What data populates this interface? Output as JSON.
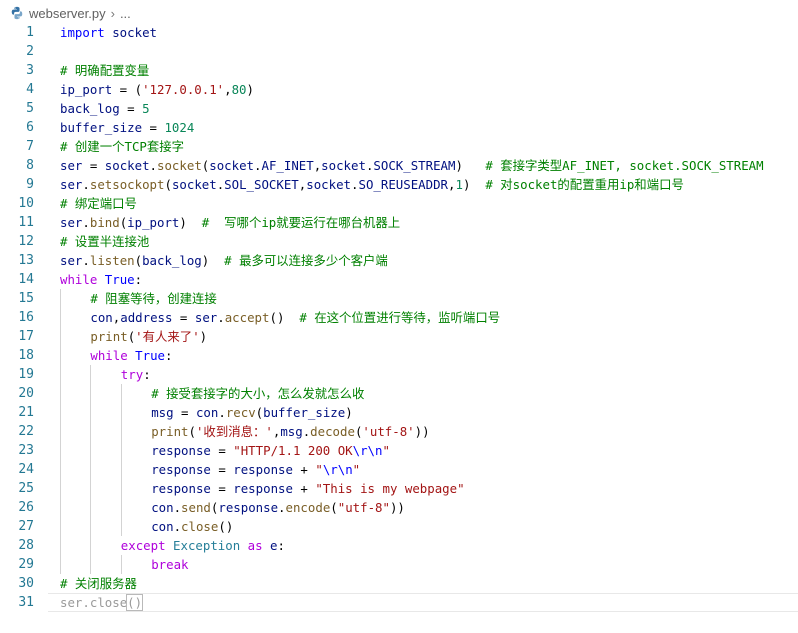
{
  "breadcrumb": {
    "file": "webserver.py",
    "separator": "›",
    "ellipsis": "..."
  },
  "colors": {
    "keyword": "#0000ff",
    "control": "#af00db",
    "comment": "#008000",
    "string": "#a31515",
    "number": "#098658",
    "function": "#795e26",
    "class": "#267f99",
    "variable": "#001080",
    "line_number": "#237893"
  },
  "lines": [
    {
      "n": "1",
      "indent": 0,
      "tokens": [
        [
          "kw",
          "import"
        ],
        [
          "v",
          " socket"
        ]
      ]
    },
    {
      "n": "2",
      "indent": 0,
      "tokens": []
    },
    {
      "n": "3",
      "indent": 0,
      "tokens": [
        [
          "cm",
          "# 明确配置变量"
        ]
      ]
    },
    {
      "n": "4",
      "indent": 0,
      "tokens": [
        [
          "v",
          "ip_port"
        ],
        [
          "op",
          " = ("
        ],
        [
          "st",
          "'127.0.0.1'"
        ],
        [
          "op",
          ","
        ],
        [
          "nu",
          "80"
        ],
        [
          "op",
          ")"
        ]
      ]
    },
    {
      "n": "5",
      "indent": 0,
      "tokens": [
        [
          "v",
          "back_log"
        ],
        [
          "op",
          " = "
        ],
        [
          "nu",
          "5"
        ]
      ]
    },
    {
      "n": "6",
      "indent": 0,
      "tokens": [
        [
          "v",
          "buffer_size"
        ],
        [
          "op",
          " = "
        ],
        [
          "nu",
          "1024"
        ]
      ]
    },
    {
      "n": "7",
      "indent": 0,
      "tokens": [
        [
          "cm",
          "# 创建一个TCP套接字"
        ]
      ]
    },
    {
      "n": "8",
      "indent": 0,
      "tokens": [
        [
          "v",
          "ser"
        ],
        [
          "op",
          " = "
        ],
        [
          "v",
          "socket"
        ],
        [
          "op",
          "."
        ],
        [
          "fn",
          "socket"
        ],
        [
          "op",
          "("
        ],
        [
          "v",
          "socket"
        ],
        [
          "op",
          "."
        ],
        [
          "v",
          "AF_INET"
        ],
        [
          "op",
          ","
        ],
        [
          "v",
          "socket"
        ],
        [
          "op",
          "."
        ],
        [
          "v",
          "SOCK_STREAM"
        ],
        [
          "op",
          ")   "
        ],
        [
          "cm",
          "# 套接字类型AF_INET, socket.SOCK_STREAM"
        ]
      ]
    },
    {
      "n": "9",
      "indent": 0,
      "tokens": [
        [
          "v",
          "ser"
        ],
        [
          "op",
          "."
        ],
        [
          "fn",
          "setsockopt"
        ],
        [
          "op",
          "("
        ],
        [
          "v",
          "socket"
        ],
        [
          "op",
          "."
        ],
        [
          "v",
          "SOL_SOCKET"
        ],
        [
          "op",
          ","
        ],
        [
          "v",
          "socket"
        ],
        [
          "op",
          "."
        ],
        [
          "v",
          "SO_REUSEADDR"
        ],
        [
          "op",
          ","
        ],
        [
          "nu",
          "1"
        ],
        [
          "op",
          ")  "
        ],
        [
          "cm",
          "# 对socket的配置重用ip和端口号"
        ]
      ]
    },
    {
      "n": "10",
      "indent": 0,
      "tokens": [
        [
          "cm",
          "# 绑定端口号"
        ]
      ]
    },
    {
      "n": "11",
      "indent": 0,
      "tokens": [
        [
          "v",
          "ser"
        ],
        [
          "op",
          "."
        ],
        [
          "fn",
          "bind"
        ],
        [
          "op",
          "("
        ],
        [
          "v",
          "ip_port"
        ],
        [
          "op",
          ")  "
        ],
        [
          "cm",
          "#  写哪个ip就要运行在哪台机器上"
        ]
      ]
    },
    {
      "n": "12",
      "indent": 0,
      "tokens": [
        [
          "cm",
          "# 设置半连接池"
        ]
      ]
    },
    {
      "n": "13",
      "indent": 0,
      "tokens": [
        [
          "v",
          "ser"
        ],
        [
          "op",
          "."
        ],
        [
          "fn",
          "listen"
        ],
        [
          "op",
          "("
        ],
        [
          "v",
          "back_log"
        ],
        [
          "op",
          ")  "
        ],
        [
          "cm",
          "# 最多可以连接多少个客户端"
        ]
      ]
    },
    {
      "n": "14",
      "indent": 0,
      "tokens": [
        [
          "kw2",
          "while"
        ],
        [
          "op",
          " "
        ],
        [
          "kw",
          "True"
        ],
        [
          "op",
          ":"
        ]
      ]
    },
    {
      "n": "15",
      "indent": 1,
      "tokens": [
        [
          "cm",
          "# 阻塞等待，创建连接"
        ]
      ]
    },
    {
      "n": "16",
      "indent": 1,
      "tokens": [
        [
          "v",
          "con"
        ],
        [
          "op",
          ","
        ],
        [
          "v",
          "address"
        ],
        [
          "op",
          " = "
        ],
        [
          "v",
          "ser"
        ],
        [
          "op",
          "."
        ],
        [
          "fn",
          "accept"
        ],
        [
          "op",
          "()  "
        ],
        [
          "cm",
          "# 在这个位置进行等待，监听端口号"
        ]
      ]
    },
    {
      "n": "17",
      "indent": 1,
      "tokens": [
        [
          "fn",
          "print"
        ],
        [
          "op",
          "("
        ],
        [
          "st",
          "'有人来了'"
        ],
        [
          "op",
          ")"
        ]
      ]
    },
    {
      "n": "18",
      "indent": 1,
      "tokens": [
        [
          "kw2",
          "while"
        ],
        [
          "op",
          " "
        ],
        [
          "kw",
          "True"
        ],
        [
          "op",
          ":"
        ]
      ]
    },
    {
      "n": "19",
      "indent": 2,
      "tokens": [
        [
          "kw2",
          "try"
        ],
        [
          "op",
          ":"
        ]
      ]
    },
    {
      "n": "20",
      "indent": 3,
      "tokens": [
        [
          "cm",
          "# 接受套接字的大小，怎么发就怎么收"
        ]
      ]
    },
    {
      "n": "21",
      "indent": 3,
      "tokens": [
        [
          "v",
          "msg"
        ],
        [
          "op",
          " = "
        ],
        [
          "v",
          "con"
        ],
        [
          "op",
          "."
        ],
        [
          "fn",
          "recv"
        ],
        [
          "op",
          "("
        ],
        [
          "v",
          "buffer_size"
        ],
        [
          "op",
          ")"
        ]
      ]
    },
    {
      "n": "22",
      "indent": 3,
      "tokens": [
        [
          "fn",
          "print"
        ],
        [
          "op",
          "("
        ],
        [
          "st",
          "'收到消息：'"
        ],
        [
          "op",
          ","
        ],
        [
          "v",
          "msg"
        ],
        [
          "op",
          "."
        ],
        [
          "fn",
          "decode"
        ],
        [
          "op",
          "("
        ],
        [
          "st",
          "'utf-8'"
        ],
        [
          "op",
          "))"
        ]
      ]
    },
    {
      "n": "23",
      "indent": 3,
      "tokens": [
        [
          "v",
          "response"
        ],
        [
          "op",
          " = "
        ],
        [
          "st",
          "\"HTTP/1.1 200 OK"
        ],
        [
          "kw",
          "\\r\\n"
        ],
        [
          "st",
          "\""
        ]
      ]
    },
    {
      "n": "24",
      "indent": 3,
      "tokens": [
        [
          "v",
          "response"
        ],
        [
          "op",
          " = "
        ],
        [
          "v",
          "response"
        ],
        [
          "op",
          " + "
        ],
        [
          "st",
          "\""
        ],
        [
          "kw",
          "\\r\\n"
        ],
        [
          "st",
          "\""
        ]
      ]
    },
    {
      "n": "25",
      "indent": 3,
      "tokens": [
        [
          "v",
          "response"
        ],
        [
          "op",
          " = "
        ],
        [
          "v",
          "response"
        ],
        [
          "op",
          " + "
        ],
        [
          "st",
          "\"This is my webpage\""
        ]
      ]
    },
    {
      "n": "26",
      "indent": 3,
      "tokens": [
        [
          "v",
          "con"
        ],
        [
          "op",
          "."
        ],
        [
          "fn",
          "send"
        ],
        [
          "op",
          "("
        ],
        [
          "v",
          "response"
        ],
        [
          "op",
          "."
        ],
        [
          "fn",
          "encode"
        ],
        [
          "op",
          "("
        ],
        [
          "st",
          "\"utf-8\""
        ],
        [
          "op",
          "))"
        ]
      ]
    },
    {
      "n": "27",
      "indent": 3,
      "tokens": [
        [
          "v",
          "con"
        ],
        [
          "op",
          "."
        ],
        [
          "fn",
          "close"
        ],
        [
          "op",
          "()"
        ]
      ]
    },
    {
      "n": "28",
      "indent": 2,
      "tokens": [
        [
          "kw2",
          "except"
        ],
        [
          "op",
          " "
        ],
        [
          "cls",
          "Exception"
        ],
        [
          "op",
          " "
        ],
        [
          "kw2",
          "as"
        ],
        [
          "op",
          " "
        ],
        [
          "v",
          "e"
        ],
        [
          "op",
          ":"
        ]
      ]
    },
    {
      "n": "29",
      "indent": 3,
      "tokens": [
        [
          "kw2",
          "break"
        ]
      ]
    },
    {
      "n": "30",
      "indent": 0,
      "tokens": [
        [
          "cm",
          "# 关闭服务器"
        ]
      ]
    },
    {
      "n": "31",
      "indent": 0,
      "tokens": [
        [
          "fade",
          "ser"
        ],
        [
          "fade",
          "."
        ],
        [
          "fade",
          "close"
        ],
        [
          "box",
          "()"
        ]
      ],
      "current": true
    }
  ]
}
